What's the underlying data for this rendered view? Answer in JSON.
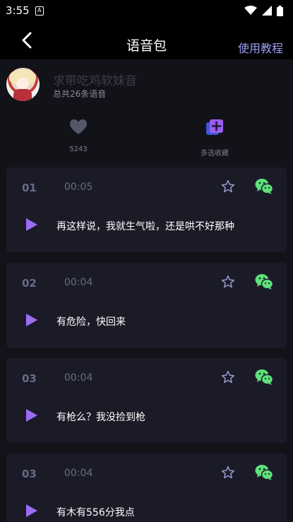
{
  "status_bar": {
    "time": "3:55",
    "sim_label": "A"
  },
  "header": {
    "title": "语音包",
    "tutorial_label": "使用教程"
  },
  "profile": {
    "name": "求带吃鸡软妹音",
    "count": "总共26条语音"
  },
  "actions": {
    "like_count": "5243",
    "multi_select_label": "多选收藏"
  },
  "voices": [
    {
      "index": "01",
      "duration": "00:05",
      "text": "再这样说，我就生气啦，还是哄不好那种"
    },
    {
      "index": "02",
      "duration": "00:04",
      "text": "有危险，快回来"
    },
    {
      "index": "03",
      "duration": "00:04",
      "text": "有枪么？我没捡到枪"
    },
    {
      "index": "03",
      "duration": "00:04",
      "text": "有木有556分我点"
    }
  ],
  "colors": {
    "background": "#121219",
    "card": "#1b1b28",
    "accent_purple": "#9c6cf5",
    "tutorial_link": "#9c9cf0",
    "wechat_green": "#5fe07a",
    "muted": "#6b6b86"
  },
  "icons": {
    "back": "chevron-left-icon",
    "like": "heart-icon",
    "multi_select": "add-collection-icon",
    "favorite": "star-icon",
    "share": "wechat-icon",
    "play": "play-icon"
  }
}
